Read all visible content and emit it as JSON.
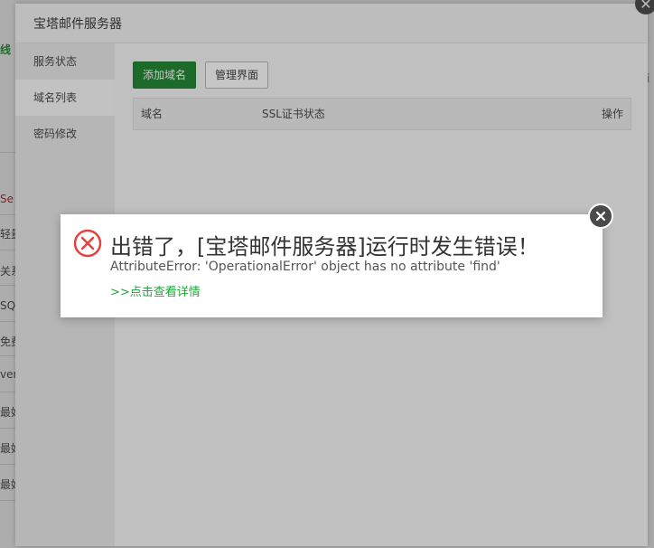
{
  "background": {
    "fragments": [
      {
        "text": "线",
        "style": "green"
      },
      {
        "text": "Se",
        "style": "red"
      },
      {
        "text": "轻量",
        "style": "normal"
      },
      {
        "text": "关系",
        "style": "normal"
      },
      {
        "text": "SQL",
        "style": "normal"
      },
      {
        "text": "免费",
        "style": "normal"
      },
      {
        "text": "ver",
        "style": "normal"
      },
      {
        "text": "最好",
        "style": "normal"
      },
      {
        "text": "最好",
        "style": "normal"
      },
      {
        "text": "最好",
        "style": "normal"
      }
    ]
  },
  "dialog": {
    "title": "宝塔邮件服务器",
    "close_symbol": "✕"
  },
  "sidebar": {
    "items": [
      {
        "label": "服务状态",
        "active": false
      },
      {
        "label": "域名列表",
        "active": true
      },
      {
        "label": "密码修改",
        "active": false
      }
    ]
  },
  "toolbar": {
    "add_domain_label": "添加域名",
    "manage_ui_label": "管理界面"
  },
  "table": {
    "columns": [
      "域名",
      "SSL证书状态",
      "操作"
    ]
  },
  "error": {
    "title": "出错了，[宝塔邮件服务器]运行时发生错误！",
    "message": "AttributeError: 'OperationalError' object has no attribute 'find'",
    "details_link": ">>点击查看详情",
    "icon_color": "#e8403f",
    "link_color": "#20a53a"
  }
}
